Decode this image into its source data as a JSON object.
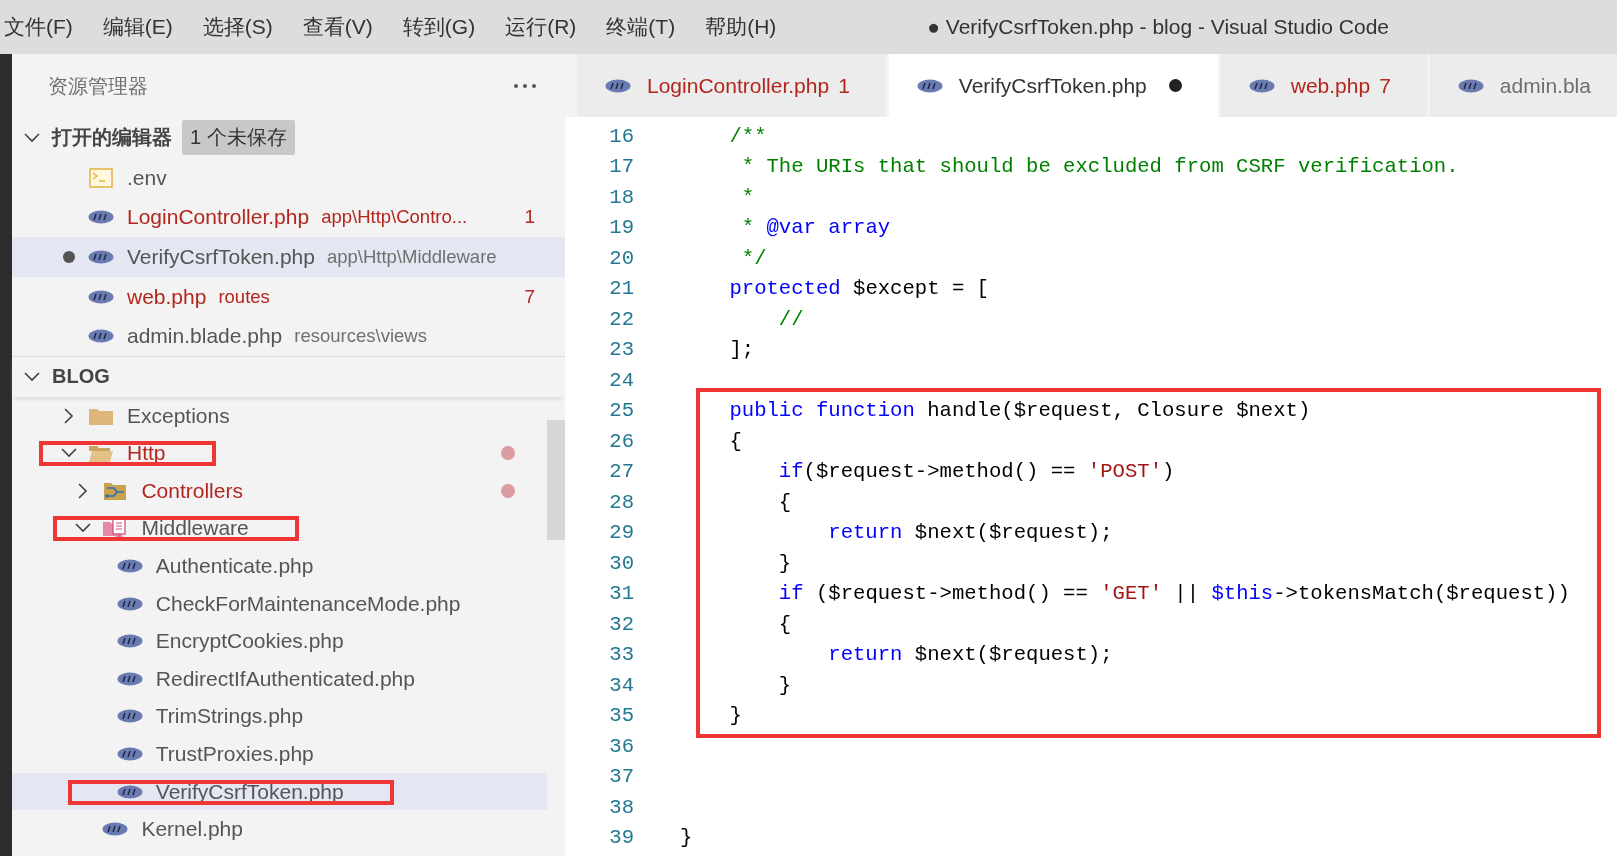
{
  "menu": [
    "文件(F)",
    "编辑(E)",
    "选择(S)",
    "查看(V)",
    "转到(G)",
    "运行(R)",
    "终端(T)",
    "帮助(H)"
  ],
  "window": {
    "title": "● VerifyCsrfToken.php - blog - Visual Studio Code"
  },
  "sidebar": {
    "title": "资源管理器",
    "open_editors": {
      "label": "打开的编辑器",
      "expanded": true,
      "badge": "1 个未保存",
      "items": [
        {
          "name": ".env",
          "kind": "env",
          "errors": false,
          "dirty": false,
          "selected": false
        },
        {
          "name": "LoginController.php",
          "kind": "php",
          "description": "app\\Http\\Contro...",
          "count": "1",
          "errors": true,
          "dirty": false,
          "selected": false
        },
        {
          "name": "VerifyCsrfToken.php",
          "kind": "php",
          "description": "app\\Http\\Middleware",
          "errors": false,
          "dirty": true,
          "selected": true
        },
        {
          "name": "web.php",
          "kind": "php",
          "description": "routes",
          "count": "7",
          "errors": true,
          "dirty": false,
          "selected": false
        },
        {
          "name": "admin.blade.php",
          "kind": "php",
          "description": "resources\\views",
          "errors": false,
          "dirty": false,
          "selected": false
        }
      ]
    },
    "workspace": {
      "label": "BLOG",
      "expanded": true,
      "tree": [
        {
          "name": "Exceptions",
          "kind": "folder",
          "expanded": false,
          "errors": false,
          "modified": false,
          "annotated": false,
          "selected": false
        },
        {
          "name": "Http",
          "kind": "folder",
          "expanded": true,
          "errors": true,
          "modified": true,
          "annotated": true,
          "selected": false,
          "children": [
            {
              "name": "Controllers",
              "kind": "controllers",
              "expanded": false,
              "errors": true,
              "modified": true,
              "annotated": false,
              "selected": false
            },
            {
              "name": "Middleware",
              "kind": "middleware",
              "expanded": true,
              "errors": false,
              "modified": false,
              "annotated": true,
              "selected": false,
              "children": [
                {
                  "name": "Authenticate.php",
                  "kind": "php",
                  "errors": false,
                  "modified": false,
                  "annotated": false,
                  "selected": false
                },
                {
                  "name": "CheckForMaintenanceMode.php",
                  "kind": "php",
                  "errors": false,
                  "modified": false,
                  "annotated": false,
                  "selected": false
                },
                {
                  "name": "EncryptCookies.php",
                  "kind": "php",
                  "errors": false,
                  "modified": false,
                  "annotated": false,
                  "selected": false
                },
                {
                  "name": "RedirectIfAuthenticated.php",
                  "kind": "php",
                  "errors": false,
                  "modified": false,
                  "annotated": false,
                  "selected": false
                },
                {
                  "name": "TrimStrings.php",
                  "kind": "php",
                  "errors": false,
                  "modified": false,
                  "annotated": false,
                  "selected": false
                },
                {
                  "name": "TrustProxies.php",
                  "kind": "php",
                  "errors": false,
                  "modified": false,
                  "annotated": false,
                  "selected": false
                },
                {
                  "name": "VerifyCsrfToken.php",
                  "kind": "php",
                  "errors": false,
                  "modified": false,
                  "annotated": true,
                  "selected": true
                }
              ]
            },
            {
              "name": "Kernel.php",
              "kind": "php",
              "errors": false,
              "modified": false,
              "annotated": false,
              "selected": false
            }
          ]
        }
      ]
    }
  },
  "tabs": [
    {
      "name": "LoginController.php",
      "count": "1",
      "errors": true,
      "dirty": false,
      "selected": false
    },
    {
      "name": "VerifyCsrfToken.php",
      "errors": false,
      "dirty": true,
      "selected": true
    },
    {
      "name": "web.php",
      "count": "7",
      "errors": true,
      "dirty": false,
      "selected": false
    },
    {
      "name": "admin.bla",
      "errors": false,
      "dirty": false,
      "selected": false
    }
  ],
  "editor": {
    "blocks": [
      {
        "boxed": false,
        "lines": [
          {
            "number": "16",
            "tokens": [
              {
                "kind": "comment",
                "text": "    /**"
              }
            ]
          },
          {
            "number": "17",
            "tokens": [
              {
                "kind": "comment",
                "text": "     * The URIs that should be excluded from CSRF verification."
              }
            ]
          },
          {
            "number": "18",
            "tokens": [
              {
                "kind": "comment",
                "text": "     *"
              }
            ]
          },
          {
            "number": "19",
            "tokens": [
              {
                "kind": "comment",
                "text": "     * "
              },
              {
                "kind": "keyword",
                "text": "@var array"
              }
            ]
          },
          {
            "number": "20",
            "tokens": [
              {
                "kind": "comment",
                "text": "     */"
              }
            ]
          },
          {
            "number": "21",
            "tokens": [
              {
                "kind": "keyword",
                "text": "    protected"
              },
              {
                "kind": "plain",
                "text": " $except = ["
              }
            ]
          },
          {
            "number": "22",
            "tokens": [
              {
                "kind": "comment",
                "text": "        //"
              }
            ]
          },
          {
            "number": "23",
            "tokens": [
              {
                "kind": "plain",
                "text": "    ];"
              }
            ]
          },
          {
            "number": "24"
          }
        ]
      },
      {
        "boxed": true,
        "lines": [
          {
            "number": "25",
            "tokens": [
              {
                "kind": "keyword",
                "text": "    public function"
              },
              {
                "kind": "plain",
                "text": " handle($request, Closure $next)"
              }
            ]
          },
          {
            "number": "26",
            "tokens": [
              {
                "kind": "plain",
                "text": "    {"
              }
            ]
          },
          {
            "number": "27",
            "tokens": [
              {
                "kind": "keyword",
                "text": "        if"
              },
              {
                "kind": "plain",
                "text": "($request->method() == "
              },
              {
                "kind": "string",
                "text": "'POST'"
              },
              {
                "kind": "plain",
                "text": ")"
              }
            ]
          },
          {
            "number": "28",
            "tokens": [
              {
                "kind": "plain",
                "text": "        {"
              }
            ]
          },
          {
            "number": "29",
            "tokens": [
              {
                "kind": "keyword",
                "text": "            return"
              },
              {
                "kind": "plain",
                "text": " $next($request);"
              }
            ]
          },
          {
            "number": "30",
            "tokens": [
              {
                "kind": "plain",
                "text": "        }"
              }
            ]
          },
          {
            "number": "31",
            "tokens": [
              {
                "kind": "keyword",
                "text": "        if"
              },
              {
                "kind": "plain",
                "text": " ($request->method() == "
              },
              {
                "kind": "string",
                "text": "'GET'"
              },
              {
                "kind": "plain",
                "text": " || "
              },
              {
                "kind": "keyword",
                "text": "$this"
              },
              {
                "kind": "plain",
                "text": "->tokensMatch($request))"
              }
            ]
          },
          {
            "number": "32",
            "tokens": [
              {
                "kind": "plain",
                "text": "        {"
              }
            ]
          },
          {
            "number": "33",
            "tokens": [
              {
                "kind": "keyword",
                "text": "            return"
              },
              {
                "kind": "plain",
                "text": " $next($request);"
              }
            ]
          },
          {
            "number": "34",
            "tokens": [
              {
                "kind": "plain",
                "text": "        }"
              }
            ]
          },
          {
            "number": "35",
            "tokens": [
              {
                "kind": "plain",
                "text": "    }"
              }
            ]
          }
        ]
      },
      {
        "boxed": false,
        "lines": [
          {
            "number": "36"
          },
          {
            "number": "37"
          },
          {
            "number": "38"
          },
          {
            "number": "39",
            "tokens": [
              {
                "kind": "plain",
                "text": "}"
              }
            ]
          }
        ]
      }
    ]
  }
}
